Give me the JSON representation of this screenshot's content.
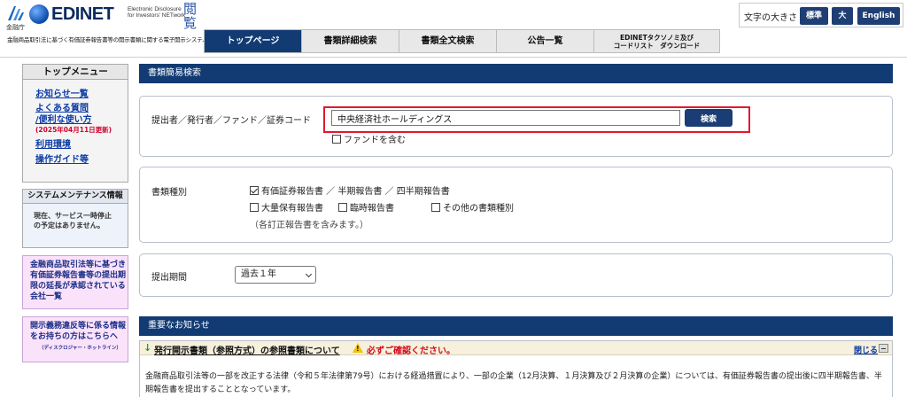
{
  "header": {
    "fsa_text": "金融庁",
    "logo_title": "EDINET",
    "logo_sub1": "Electronic Disclosure",
    "logo_sub2": "for Investors' NETwork",
    "logo_kan": "閲覧",
    "logo_desc": "金融商品取引法に基づく有価証券報告書等の開示書類に関する電子開示システム",
    "font_size_label": "文字の大きさ",
    "font_std": "標準",
    "font_large": "大",
    "english": "English"
  },
  "nav": {
    "tabs": [
      {
        "label": "トップページ"
      },
      {
        "label": "書類詳細検索"
      },
      {
        "label": "書類全文検索"
      },
      {
        "label": "公告一覧"
      },
      {
        "label_line1": "EDINETタクソノミ及び",
        "label_line2": "コードリスト　ダウンロード"
      }
    ]
  },
  "sidebar": {
    "menu_title": "トップメニュー",
    "links": [
      "お知らせ一覧",
      "よくある質問",
      "/便利な使い方",
      "利用環境",
      "操作ガイド等"
    ],
    "updated": "(2025年04月11日更新)",
    "maint_title": "システムメンテナンス情報",
    "maint_line1": "現在、サービス一時停止",
    "maint_line2": "の予定はありません。",
    "pink1_lines": [
      "金融商品取引法等に基づき",
      "有価証券報告書等の提出期",
      "限の延長が承認されている",
      "会社一覧"
    ],
    "pink2_lines": [
      "開示義務違反等に係る情報",
      "をお持ちの方はこちらへ"
    ],
    "pink2_small": "（ディスクロジャー・ホットライン）"
  },
  "search": {
    "title": "書類簡易検索",
    "submitter_label": "提出者／発行者／ファンド／証券コード",
    "query": "中央経済社ホールディングス",
    "search_button": "検索",
    "fund_label": "ファンドを含む",
    "doc_type_label": "書類種別",
    "doc_types": [
      {
        "label": "有価証券報告書 ／ 半期報告書 ／ 四半期報告書",
        "checked": true
      },
      {
        "label": "大量保有報告書",
        "checked": false
      },
      {
        "label": "臨時報告書",
        "checked": false
      },
      {
        "label": "その他の書類種別",
        "checked": false
      }
    ],
    "amend_note": "（各訂正報告書を含みます。）",
    "period_label": "提出期間",
    "period_value": "過去１年"
  },
  "notice": {
    "title": "重要なお知らせ",
    "link": "発行開示書類（参照方式）の参照書類について",
    "warn": "必ずご確認ください。",
    "close": "閉じる",
    "text": "金融商品取引法等の一部を改正する法律（令和５年法律第79号）における経過措置により、一部の企業（12月決算、１月決算及び２月決算の企業）については、有価証券報告書の提出後に四半期報告書、半期報告書を提出することとなっています。"
  },
  "colors": {
    "navy": "#123b73",
    "highlight_red": "#e0192d",
    "link_blue": "#0b3aa5",
    "pink_bg": "#fbe2fb"
  }
}
